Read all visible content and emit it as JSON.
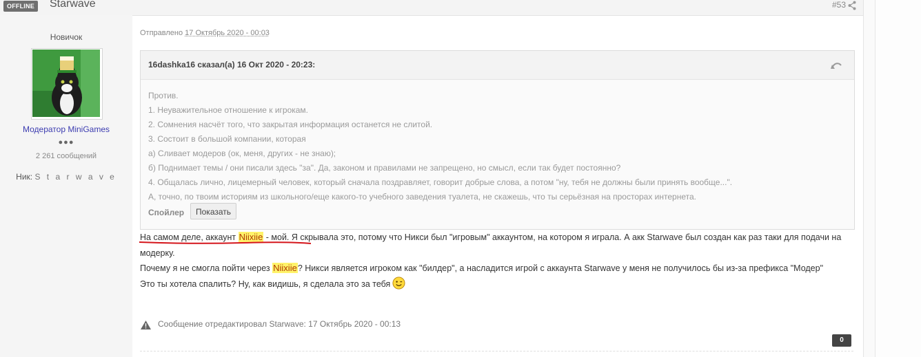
{
  "post": {
    "status": "OFFLINE",
    "author": "Starwave",
    "number": "#53",
    "sent_label": "Отправлено",
    "sent_date": "17 Октябрь 2020 - 00:03"
  },
  "author_info": {
    "rank": "Новичок",
    "group": "Модератор MiniGames",
    "dots": "●●●",
    "posts_count": "2 261 сообщений",
    "nick_label": "Ник:",
    "nick_value": "S t a r w a v e"
  },
  "quote": {
    "citation": "16dashka16 сказал(а) 16 Окт 2020 - 20:23:",
    "lines": [
      "Против.",
      "1. Неуважительное отношение к игрокам.",
      "2. Сомнения насчёт того, что закрытая информация останется не слитой.",
      "3. Состоит в большой компании, которая",
      "а) Сливает модеров (ок, меня, других - не знаю);",
      "б) Поднимает темы / они писали здесь \"за\". Да, законом и правилами не запрещено, но смысл, если так будет постоянно?",
      "4. Общалась лично, лицемерный человек, который сначала поздравляет, говорит добрые слова, а потом \"ну, тебя не должны были принять вообще...\".",
      "А, точно, по твоим историям из школьного/еще какого-то учебного заведения туалета, не скажешь, что ты серьёзная на просторах интернета."
    ],
    "spoiler_label": "Спойлер",
    "spoiler_button": "Показать"
  },
  "message": {
    "p1_a": "На самом деле, аккаунт ",
    "p1_hl": "Niixiie",
    "p1_b": " - мой. Я скрывала это, потому что Никси был \"игровым\" аккаунтом, на котором я играла. А акк Starwave был создан как раз таки для подачи на модерку.",
    "p2_a": "Почему я не смогла пойти через ",
    "p2_hl": "Niixiie",
    "p2_b": "? Никси является игроком как \"билдер\", а насладится игрой с аккаунта Starwave у меня не получилось бы из-за префикса \"Модер\"",
    "p3": "Это ты хотела спалить? Ну, как видишь, я сделала это за тебя"
  },
  "edited": "Сообщение отредактировал Starwave: 17 Октябрь 2020 - 00:13",
  "reputation": "0",
  "colors": {
    "highlight_bg": "#fff36a",
    "highlight_text": "#b03b00",
    "underline": "#d4141a",
    "group_link": "#3b3bb0",
    "badge": "#6f6f6f"
  }
}
